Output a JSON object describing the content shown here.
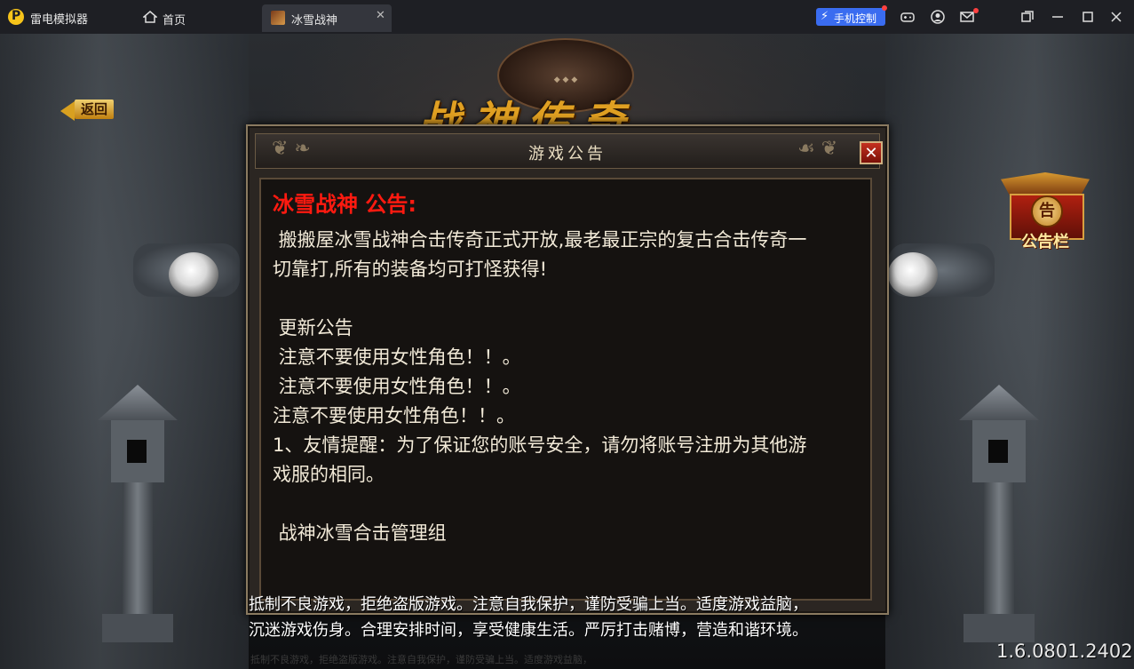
{
  "window": {
    "app_name": "雷电模拟器",
    "tabs": [
      {
        "label": "首页"
      },
      {
        "label": "冰雪战神"
      }
    ],
    "phone_control_label": "手机控制"
  },
  "game": {
    "back_label": "返回",
    "logo_text": "战神传奇",
    "notice_board": {
      "medal": "告",
      "label": "公告栏"
    },
    "dialog": {
      "title": "游戏公告",
      "close_symbol": "✕",
      "notice_title": "冰雪战神 公告:",
      "lines": [
        " 搬搬屋冰雪战神合击传奇正式开放,最老最正宗的复古合击传奇一",
        "切靠打,所有的装备均可打怪获得!",
        "",
        " 更新公告",
        " 注意不要使用女性角色！！。",
        " 注意不要使用女性角色！！。",
        "注意不要使用女性角色！！。",
        "1、友情提醒：为了保证您的账号安全，请勿将账号注册为其他游",
        "戏服的相同。",
        "",
        " 战神冰雪合击管理组"
      ]
    },
    "footer": {
      "line1": "抵制不良游戏，拒绝盗版游戏。注意自我保护，谨防受骗上当。适度游戏益脑，",
      "line2": "沉迷游戏伤身。合理安排时间，享受健康生活。严厉打击赌博，营造和谐环境。"
    },
    "version": "1.6.0801.2402"
  }
}
